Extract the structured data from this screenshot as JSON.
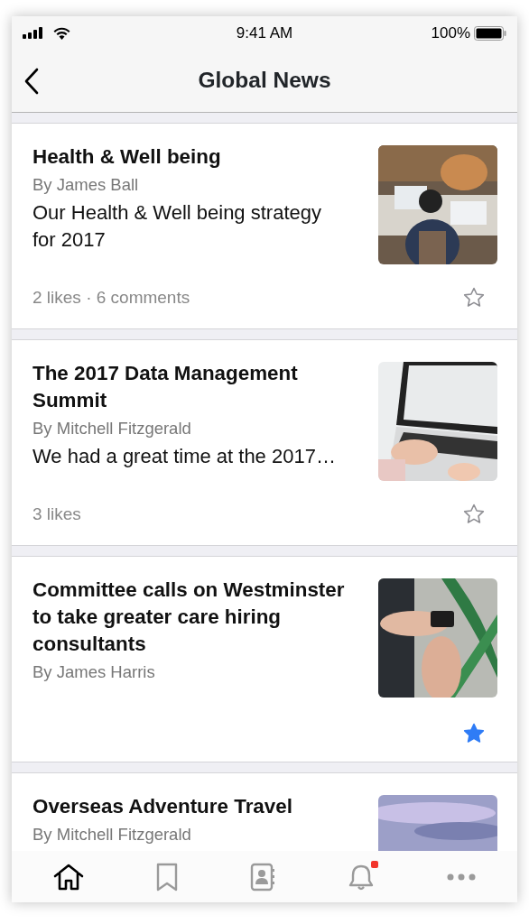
{
  "status_bar": {
    "time": "9:41 AM",
    "battery": "100%"
  },
  "nav": {
    "title": "Global News"
  },
  "articles": [
    {
      "title": "Health & Well being",
      "author": "By James Ball",
      "snippet": "Our Health & Well being strategy for 2017",
      "meta": "2 likes · 6 comments",
      "starred": false
    },
    {
      "title": "The 2017 Data Management Summit",
      "author": "By Mitchell Fitzgerald",
      "snippet": "We had a great time at the 2017…",
      "meta": "3 likes",
      "starred": false
    },
    {
      "title": "Committee calls on Westminster to take greater care hiring consultants",
      "author": "By James Harris",
      "starred": true
    },
    {
      "title": "Overseas Adventure Travel",
      "author": "By Mitchell Fitzgerald"
    }
  ],
  "tab_bar": [
    {
      "kind": "home",
      "selected": true,
      "badge": false
    },
    {
      "kind": "bookmark",
      "selected": false,
      "badge": false
    },
    {
      "kind": "contacts",
      "selected": false,
      "badge": false
    },
    {
      "kind": "notifications",
      "selected": false,
      "badge": true
    },
    {
      "kind": "more",
      "selected": false,
      "badge": false
    }
  ]
}
